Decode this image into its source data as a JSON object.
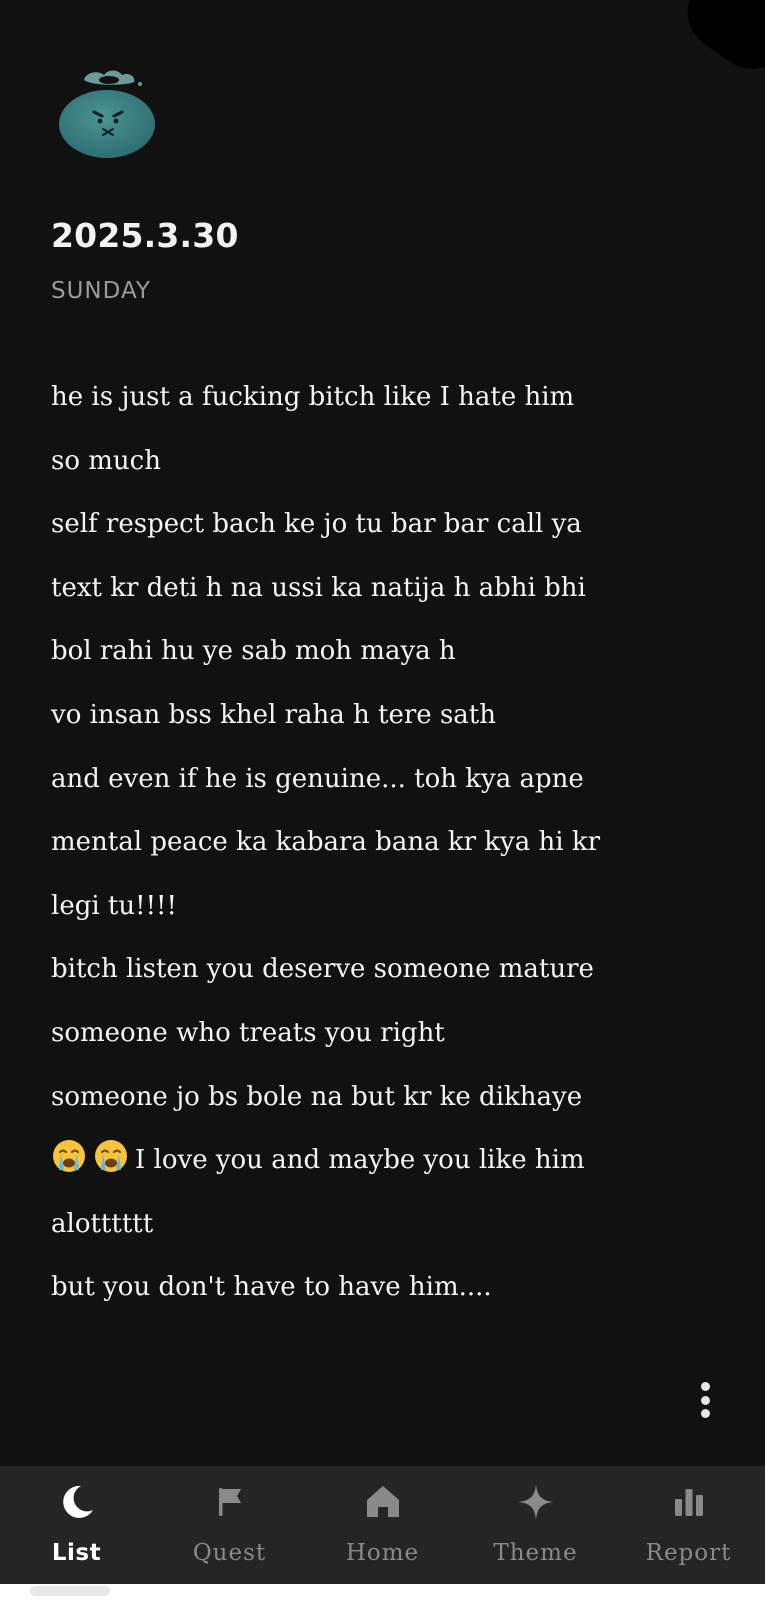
{
  "entry": {
    "date": "2025.3.30",
    "weekday": "SUNDAY",
    "mood_icon": "angry-cloud-mood-icon",
    "lines": [
      {
        "text": "he is just a fucking bitch like I hate him"
      },
      {
        "text": "so much"
      },
      {
        "text": "self respect bach ke jo tu bar bar call ya"
      },
      {
        "text": "text kr deti h na ussi ka natija h abhi bhi"
      },
      {
        "text": "bol rahi hu ye sab moh maya h"
      },
      {
        "text": "vo insan bss khel raha h tere sath"
      },
      {
        "text": "and even if he is genuine... toh kya apne"
      },
      {
        "text": "mental peace ka kabara bana kr kya hi kr"
      },
      {
        "text": "legi tu!!!!"
      },
      {
        "text": "bitch listen you deserve someone mature"
      },
      {
        "text": "someone who treats you right"
      },
      {
        "text": "someone jo bs bole na but kr ke dikhaye"
      },
      {
        "text": "I love you and maybe you like him",
        "emoji": [
          "crying-face",
          "crying-face"
        ]
      },
      {
        "text": "alotttttt"
      },
      {
        "text": "but you don't have to have him...."
      }
    ]
  },
  "more_menu_icon": "vertical-ellipsis-icon",
  "tabs": [
    {
      "label": "List",
      "icon": "moon-icon",
      "active": true
    },
    {
      "label": "Quest",
      "icon": "flag-icon",
      "active": false
    },
    {
      "label": "Home",
      "icon": "house-icon",
      "active": false
    },
    {
      "label": "Theme",
      "icon": "sparkle-icon",
      "active": false
    },
    {
      "label": "Report",
      "icon": "bar-chart-icon",
      "active": false
    }
  ],
  "colors": {
    "background": "#111112",
    "tab_bar": "#252526",
    "text": "#f4f4f4",
    "muted_text": "#9a9a9a",
    "mood_teal": "#3f8a8a"
  }
}
